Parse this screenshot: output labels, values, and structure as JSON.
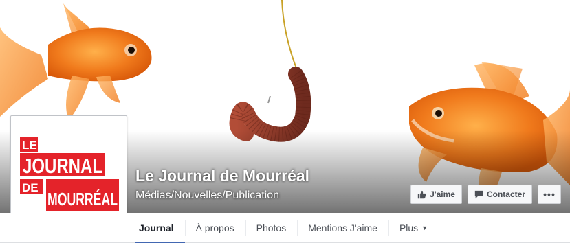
{
  "page": {
    "name": "Le Journal de Mourréal",
    "category": "Médias/Nouvelles/Publication"
  },
  "logo": {
    "line1": "LE",
    "line2": "JOURNAL",
    "line3": "DE",
    "line4": "MOURRÉAL",
    "color": "#e4232a"
  },
  "actions": {
    "like_label": "J'aime",
    "contact_label": "Contacter",
    "more_label": "•••"
  },
  "tabs": [
    {
      "label": "Journal"
    },
    {
      "label": "À propos"
    },
    {
      "label": "Photos"
    },
    {
      "label": "Mentions J'aime"
    },
    {
      "label": "Plus"
    }
  ],
  "colors": {
    "accent": "#4267b2",
    "goldfish": "#f07a1c",
    "worm": "#8a3b2a"
  }
}
